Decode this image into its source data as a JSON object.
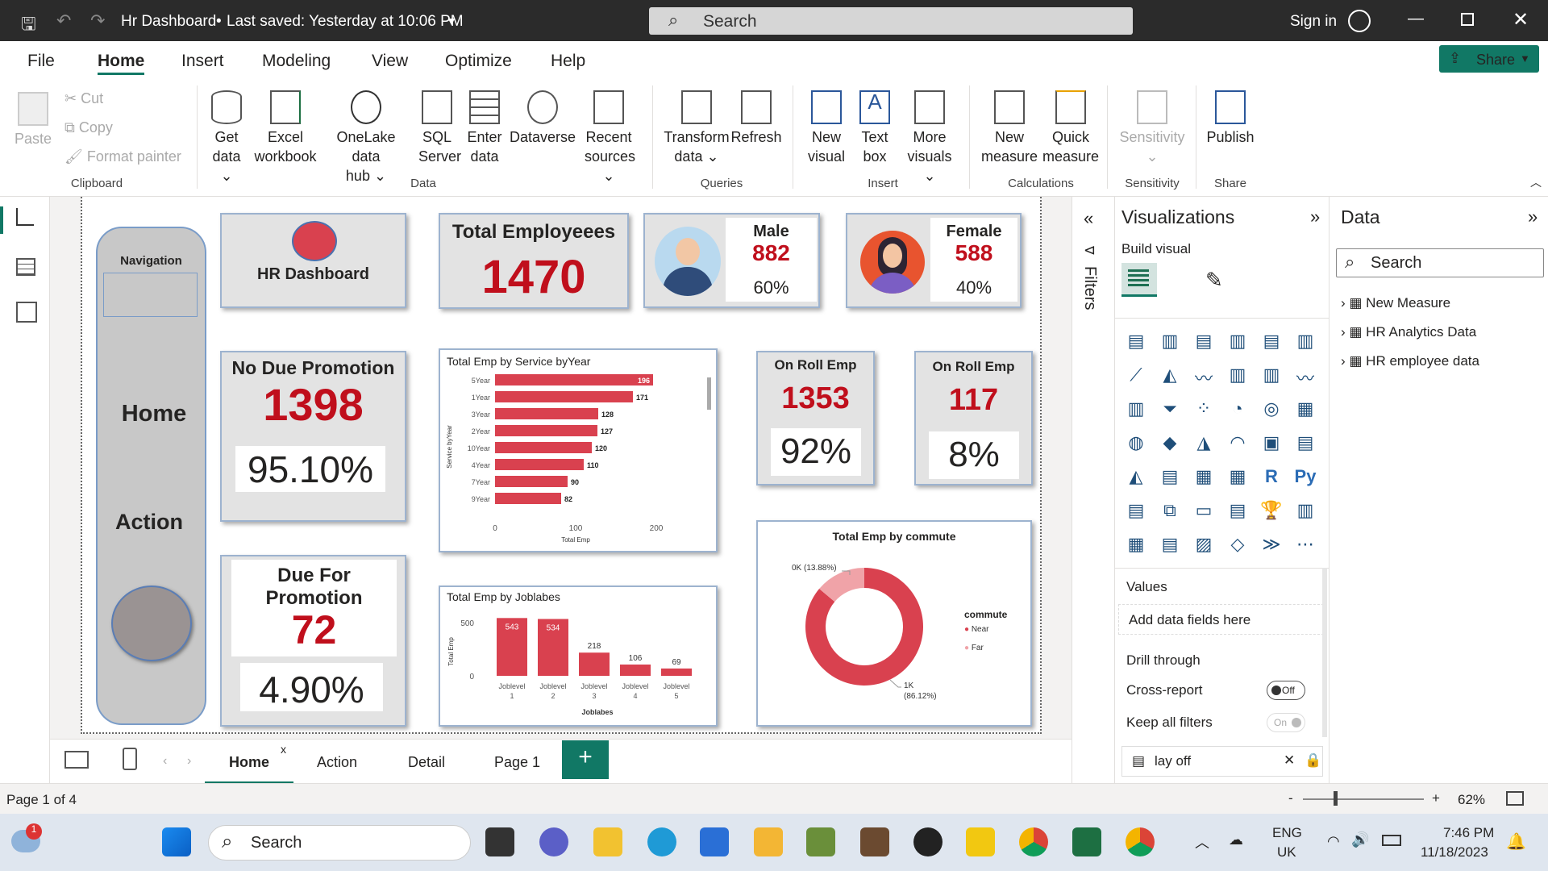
{
  "titlebar": {
    "title": "Hr Dashboard",
    "saved": "Last saved: Yesterday at 10:06 PM",
    "search": "Search",
    "signin": "Sign in"
  },
  "menu": {
    "file": "File",
    "home": "Home",
    "insert": "Insert",
    "modeling": "Modeling",
    "view": "View",
    "optimize": "Optimize",
    "help": "Help",
    "share": "Share"
  },
  "ribbon": {
    "clipboard": {
      "paste": "Paste",
      "cut": "Cut",
      "copy": "Copy",
      "format": "Format painter",
      "group": "Clipboard"
    },
    "data": {
      "get": "Get",
      "get2": "data",
      "excel": "Excel",
      "excel2": "workbook",
      "onelake": "OneLake data",
      "onelake2": "hub",
      "sql": "SQL",
      "sql2": "Server",
      "enter": "Enter",
      "enter2": "data",
      "dataverse": "Dataverse",
      "recent": "Recent",
      "recent2": "sources",
      "group": "Data"
    },
    "queries": {
      "transform": "Transform",
      "transform2": "data",
      "refresh": "Refresh",
      "group": "Queries"
    },
    "insert": {
      "newvis": "New",
      "newvis2": "visual",
      "text": "Text",
      "text2": "box",
      "more": "More",
      "more2": "visuals",
      "group": "Insert"
    },
    "calc": {
      "newm": "New",
      "newm2": "measure",
      "quick": "Quick",
      "quick2": "measure",
      "group": "Calculations"
    },
    "sens": {
      "label": "Sensitivity",
      "group": "Sensitivity"
    },
    "share": {
      "publish": "Publish",
      "group": "Share"
    }
  },
  "report": {
    "nav": {
      "title": "Navigation",
      "home": "Home",
      "action": "Action"
    },
    "title": "HR Dashboard",
    "total": {
      "label": "Total Employeees",
      "value": "1470"
    },
    "male": {
      "label": "Male",
      "value": "882",
      "pct": "60%"
    },
    "female": {
      "label": "Female",
      "value": "588",
      "pct": "40%"
    },
    "nodue": {
      "label": "No Due Promotion",
      "value": "1398",
      "pct": "95.10%"
    },
    "due": {
      "label1": "Due For",
      "label2": "Promotion",
      "value": "72",
      "pct": "4.90%"
    },
    "onroll1": {
      "label": "On Roll Emp",
      "value": "1353",
      "pct": "92%"
    },
    "onroll2": {
      "label": "On Roll Emp",
      "value": "117",
      "pct": "8%"
    },
    "commute_labels": {
      "ok": "0K (13.88%)",
      "onek": "1K",
      "onek_pct": "(86.12%)"
    }
  },
  "chart_data": [
    {
      "type": "bar",
      "title": "Total Emp by Service byYear",
      "orientation": "horizontal",
      "categories": [
        "5Year",
        "1Year",
        "3Year",
        "2Year",
        "10Year",
        "4Year",
        "7Year",
        "9Year"
      ],
      "values": [
        196,
        171,
        128,
        127,
        120,
        110,
        90,
        82
      ],
      "xlabel": "Total Emp",
      "ylabel": "Service byYear",
      "xlim": [
        0,
        200
      ],
      "ticks": [
        "0",
        "100",
        "200"
      ],
      "color": "#d9414f"
    },
    {
      "type": "bar",
      "title": "Total Emp by Joblabes",
      "categories": [
        "Joblevel 1",
        "Joblevel 2",
        "Joblevel 3",
        "Joblevel 4",
        "Joblevel 5"
      ],
      "values": [
        543,
        534,
        218,
        106,
        69
      ],
      "xlabel": "Joblabes",
      "ylabel": "Total Emp",
      "ylim": [
        0,
        500
      ],
      "ticks": [
        "0",
        "500"
      ],
      "color": "#d9414f"
    },
    {
      "type": "pie",
      "title": "Total Emp by commute",
      "legend_title": "commute",
      "series": [
        {
          "name": "Near",
          "value": 1266,
          "color": "#d9414f"
        },
        {
          "name": "Far",
          "value": 204,
          "color": "#f0a3a8"
        }
      ]
    }
  ],
  "viz": {
    "title": "Visualizations",
    "build": "Build visual",
    "values": "Values",
    "add": "Add data fields here",
    "drill": "Drill through",
    "cross": "Cross-report",
    "crossv": "Off",
    "keep": "Keep all filters",
    "keepv": "On",
    "layoff": "lay off"
  },
  "filters": {
    "label": "Filters"
  },
  "datapane": {
    "title": "Data",
    "search": "Search",
    "items": [
      "New Measure",
      "HR Analytics Data",
      "HR employee data"
    ]
  },
  "tabs": {
    "home": "Home",
    "action": "Action",
    "detail": "Detail",
    "page1": "Page 1"
  },
  "status": {
    "page": "Page 1 of 4",
    "zoom": "62%"
  },
  "taskbar": {
    "search": "Search",
    "lang1": "ENG",
    "lang2": "UK",
    "time": "7:46 PM",
    "date": "11/18/2023"
  }
}
